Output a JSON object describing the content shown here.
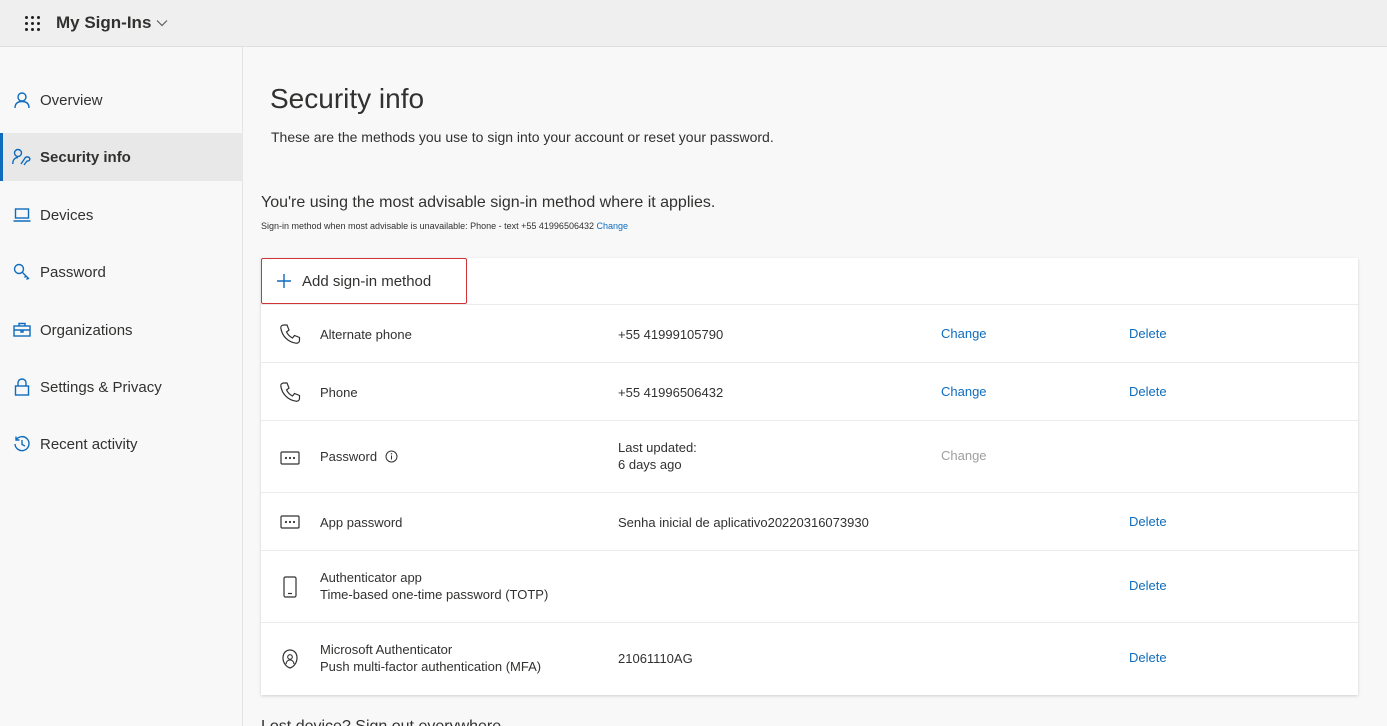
{
  "header": {
    "app_title": "My Sign-Ins",
    "waffle_icon": "app-launcher-icon",
    "dropdown_icon": "chevron-down-icon"
  },
  "sidebar": {
    "items": [
      {
        "label": "Overview",
        "icon": "person-icon",
        "active": false
      },
      {
        "label": "Security info",
        "icon": "security-person-key-icon",
        "active": true
      },
      {
        "label": "Devices",
        "icon": "laptop-icon",
        "active": false
      },
      {
        "label": "Password",
        "icon": "key-icon",
        "active": false
      },
      {
        "label": "Organizations",
        "icon": "briefcase-icon",
        "active": false
      },
      {
        "label": "Settings & Privacy",
        "icon": "lock-icon",
        "active": false
      },
      {
        "label": "Recent activity",
        "icon": "history-icon",
        "active": false
      }
    ]
  },
  "main": {
    "title": "Security info",
    "subtitle": "These are the methods you use to sign into your account or reset your password.",
    "advisable_text": "You're using the most advisable sign-in method where it applies.",
    "fallback_text": "Sign-in method when most advisable is unavailable: Phone - text +55 41996506432",
    "fallback_change_link": "Change",
    "add_method_label": "Add sign-in method",
    "methods": [
      {
        "name": "Alternate phone",
        "icon": "phone-icon",
        "detail": "+55 41999105790",
        "change": "Change",
        "delete": "Delete"
      },
      {
        "name": "Phone",
        "icon": "phone-icon",
        "detail": "+55 41996506432",
        "change": "Change",
        "delete": "Delete"
      },
      {
        "name": "Password",
        "icon": "password-dots-icon",
        "detail_line1": "Last updated:",
        "detail_line2": "6 days ago",
        "change": "Change",
        "change_disabled": true
      },
      {
        "name": "App password",
        "icon": "password-dots-icon",
        "detail": "Senha inicial de aplicativo20220316073930",
        "delete": "Delete"
      },
      {
        "name": "Authenticator app",
        "name_line2": "Time-based one-time password (TOTP)",
        "icon": "mobile-device-icon",
        "delete": "Delete"
      },
      {
        "name": "Microsoft Authenticator",
        "name_line2": "Push multi-factor authentication (MFA)",
        "icon": "authenticator-icon",
        "detail": "21061110AG",
        "delete": "Delete"
      }
    ],
    "next_section_cut": "Lost device? Sign out everywhere"
  },
  "colors": {
    "link": "#0f6cbd",
    "highlight_border": "#d13438",
    "active_bar": "#0f6cbd",
    "background": "#f8f8f8"
  }
}
